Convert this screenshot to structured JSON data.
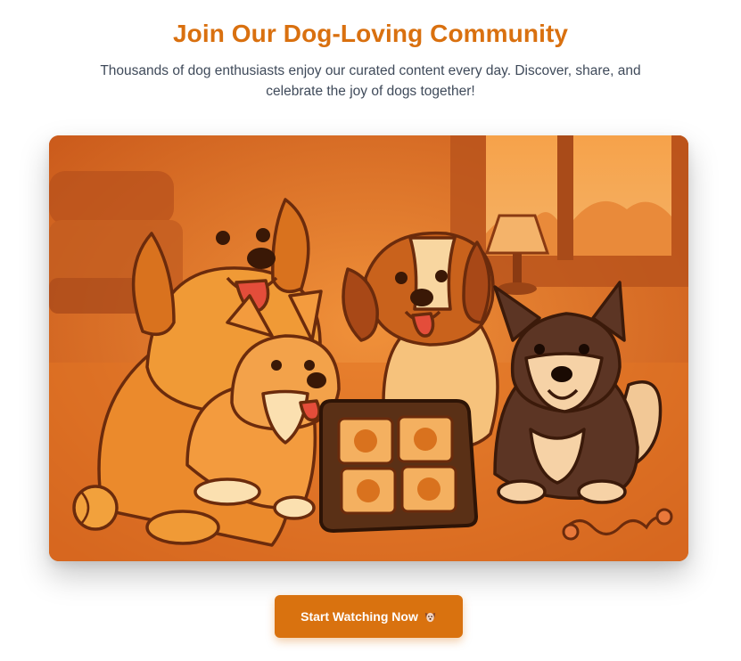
{
  "header": {
    "title": "Join Our Dog-Loving Community",
    "subtitle": "Thousands of dog enthusiasts enjoy our curated content every day. Discover, share, and celebrate the joy of dogs together!"
  },
  "hero": {
    "illustration": "dogs-watching-tablet-illustration"
  },
  "cta": {
    "label": "Start Watching Now",
    "icon": "dog-face-icon"
  },
  "colors": {
    "accent": "#d9720f",
    "title": "#d9700f",
    "text": "#3f4a5a"
  }
}
